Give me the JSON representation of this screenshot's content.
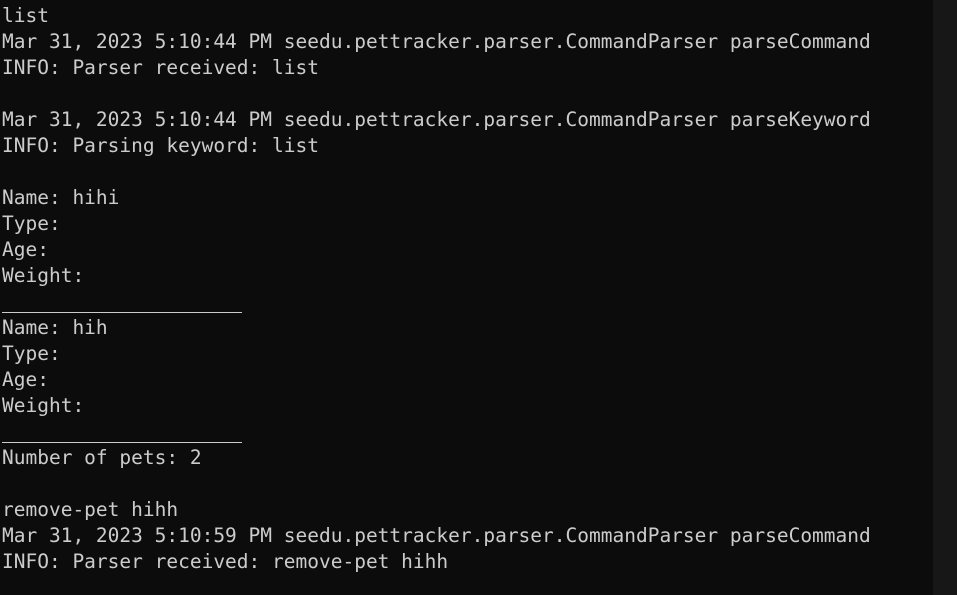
{
  "terminal": {
    "lines": [
      {
        "text": "list",
        "kind": "input"
      },
      {
        "text": "Mar 31, 2023 5:10:44 PM seedu.pettracker.parser.CommandParser parseCommand",
        "kind": "log"
      },
      {
        "text": "INFO: Parser received: list",
        "kind": "log"
      },
      {
        "text": "",
        "kind": "blank"
      },
      {
        "text": "Mar 31, 2023 5:10:44 PM seedu.pettracker.parser.CommandParser parseKeyword",
        "kind": "log"
      },
      {
        "text": "INFO: Parsing keyword: list",
        "kind": "log"
      },
      {
        "text": "",
        "kind": "blank"
      },
      {
        "text": "Name: hihi",
        "kind": "output"
      },
      {
        "text": "Type:",
        "kind": "output"
      },
      {
        "text": "Age:",
        "kind": "output"
      },
      {
        "text": "Weight:",
        "kind": "output"
      },
      {
        "text": "",
        "kind": "separator"
      },
      {
        "text": "Name: hih",
        "kind": "output"
      },
      {
        "text": "Type:",
        "kind": "output"
      },
      {
        "text": "Age:",
        "kind": "output"
      },
      {
        "text": "Weight:",
        "kind": "output"
      },
      {
        "text": "",
        "kind": "separator"
      },
      {
        "text": "Number of pets: 2",
        "kind": "output"
      },
      {
        "text": "",
        "kind": "blank"
      },
      {
        "text": "remove-pet hihh",
        "kind": "input"
      },
      {
        "text": "Mar 31, 2023 5:10:59 PM seedu.pettracker.parser.CommandParser parseCommand",
        "kind": "log"
      },
      {
        "text": "INFO: Parser received: remove-pet hihh",
        "kind": "log"
      }
    ]
  },
  "colors": {
    "background": "#0c0c0c",
    "text": "#cccccc",
    "scrollbar_track": "#171717"
  }
}
